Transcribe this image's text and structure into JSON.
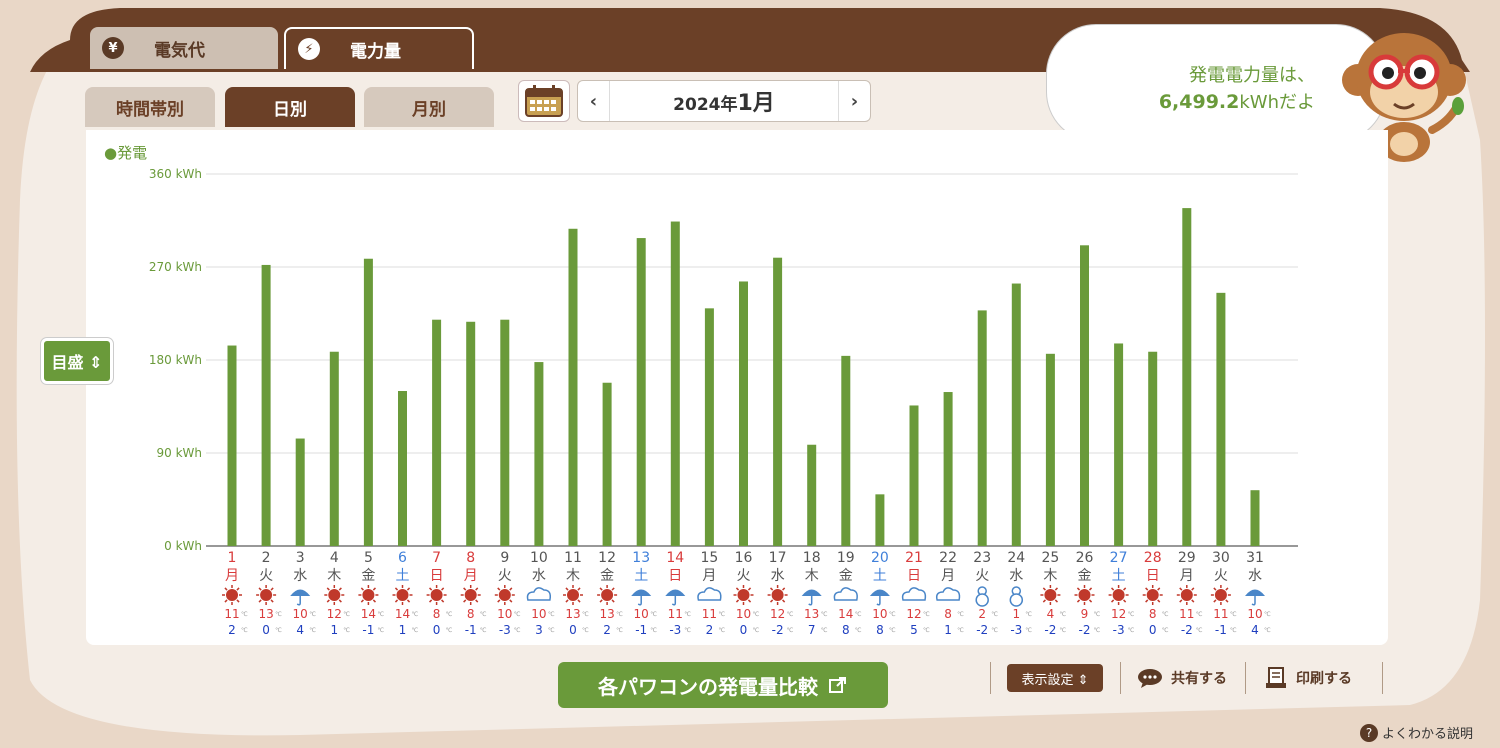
{
  "colors": {
    "brown": "#6b4027",
    "green": "#6a9a3a",
    "sunday_red": "#d93c3c",
    "saturday_blue": "#3f7fd9",
    "weekday_gray": "#555555"
  },
  "main_tabs": {
    "cost": {
      "label": "電気代",
      "icon": "yen-icon"
    },
    "power": {
      "label": "電力量",
      "icon": "lightning-icon"
    }
  },
  "sub_tabs": {
    "hourly": "時間帯別",
    "daily": "日別",
    "monthly": "月別"
  },
  "date_nav": {
    "prev": "‹",
    "next": "›",
    "year_part": "2024年",
    "month_part": "1月"
  },
  "bubble": {
    "line1": "発電電力量は、",
    "value": "6,499.2",
    "unit_suffix": "kWhだよ"
  },
  "scale_button": "目盛 ⇕",
  "chart_data": {
    "type": "bar",
    "legend": "●発電",
    "unit": "kWh",
    "ylim": [
      0,
      360
    ],
    "y_ticks": [
      "0 kWh",
      "90 kWh",
      "180 kWh",
      "270 kWh",
      "360 kWh"
    ],
    "days": [
      "1",
      "2",
      "3",
      "4",
      "5",
      "6",
      "7",
      "8",
      "9",
      "10",
      "11",
      "12",
      "13",
      "14",
      "15",
      "16",
      "17",
      "18",
      "19",
      "20",
      "21",
      "22",
      "23",
      "24",
      "25",
      "26",
      "27",
      "28",
      "29",
      "30",
      "31"
    ],
    "weekdays": [
      "月",
      "火",
      "水",
      "木",
      "金",
      "土",
      "日",
      "月",
      "火",
      "水",
      "木",
      "金",
      "土",
      "日",
      "月",
      "火",
      "水",
      "木",
      "金",
      "土",
      "日",
      "月",
      "火",
      "水",
      "木",
      "金",
      "土",
      "日",
      "月",
      "火",
      "水"
    ],
    "day_types": [
      "holiday",
      "weekday",
      "weekday",
      "weekday",
      "weekday",
      "saturday",
      "holiday",
      "holiday",
      "weekday",
      "weekday",
      "weekday",
      "weekday",
      "saturday",
      "holiday",
      "weekday",
      "weekday",
      "weekday",
      "weekday",
      "weekday",
      "saturday",
      "holiday",
      "weekday",
      "weekday",
      "weekday",
      "weekday",
      "weekday",
      "saturday",
      "holiday",
      "weekday",
      "weekday",
      "weekday"
    ],
    "values": [
      194,
      272,
      104,
      188,
      278,
      150,
      219,
      217,
      219,
      178,
      307,
      158,
      298,
      314,
      230,
      256,
      279,
      98,
      184,
      50,
      136,
      149,
      228,
      254,
      186,
      291,
      196,
      188,
      327,
      245,
      54
    ],
    "weather": [
      "sun",
      "sun",
      "rain",
      "sun",
      "sun",
      "sun",
      "sun",
      "sun",
      "sun",
      "cloud",
      "sun",
      "sun",
      "rain",
      "rain",
      "cloud",
      "sun",
      "sun",
      "rain",
      "cloud",
      "rain",
      "cloud",
      "cloud",
      "snow",
      "snow",
      "sun",
      "sun",
      "sun",
      "sun",
      "sun",
      "sun",
      "rain"
    ],
    "temp_high": [
      "11",
      "13",
      "10",
      "12",
      "14",
      "14",
      "8",
      "8",
      "10",
      "10",
      "13",
      "13",
      "10",
      "11",
      "11",
      "10",
      "12",
      "13",
      "14",
      "10",
      "12",
      "8",
      "2",
      "1",
      "4",
      "9",
      "12",
      "8",
      "11",
      "11",
      "10"
    ],
    "temp_low": [
      "2",
      "0",
      "4",
      "1",
      "-1",
      "1",
      "0",
      "-1",
      "-3",
      "3",
      "0",
      "2",
      "-1",
      "-3",
      "2",
      "0",
      "-2",
      "7",
      "8",
      "8",
      "5",
      "1",
      "-2",
      "-3",
      "-2",
      "-2",
      "-3",
      "0",
      "-2",
      "-1",
      "4"
    ],
    "temp_unit": "℃"
  },
  "bottom": {
    "compare_label": "各パワコンの発電量比較",
    "display_settings": "表示設定 ⇕",
    "share": "共有する",
    "print": "印刷する",
    "help": "よくわかる説明"
  }
}
